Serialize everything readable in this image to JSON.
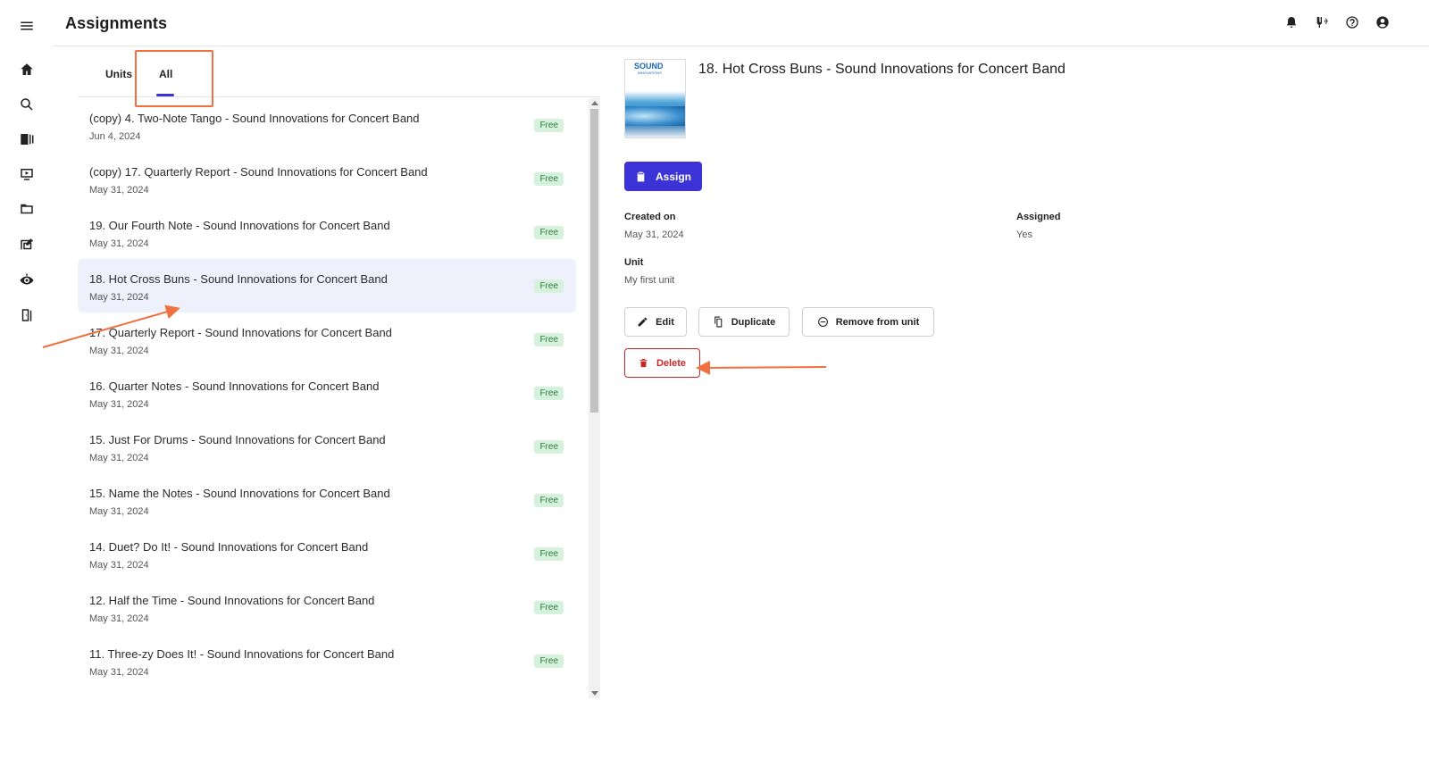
{
  "header": {
    "title": "Assignments"
  },
  "rail": {
    "icons": [
      "menu-icon",
      "home-icon",
      "search-icon",
      "library-icon",
      "video-icon",
      "folder-icon",
      "edit-music-icon",
      "pitch-icon",
      "exit-icon"
    ]
  },
  "topbar": {
    "icons": [
      "bell-icon",
      "tuner-icon",
      "help-icon",
      "account-icon"
    ]
  },
  "tabs": [
    {
      "label": "Units"
    },
    {
      "label": "All",
      "selected": true
    }
  ],
  "assignments": [
    {
      "title": "(copy) 4. Two-Note Tango - Sound Innovations for Concert Band",
      "date": "Jun 4, 2024",
      "badge": "Free"
    },
    {
      "title": "(copy) 17. Quarterly Report - Sound Innovations for Concert Band",
      "date": "May 31, 2024",
      "badge": "Free"
    },
    {
      "title": "19. Our Fourth Note - Sound Innovations for Concert Band",
      "date": "May 31, 2024",
      "badge": "Free"
    },
    {
      "title": "18. Hot Cross Buns - Sound Innovations for Concert Band",
      "date": "May 31, 2024",
      "badge": "Free",
      "selected": true
    },
    {
      "title": "17. Quarterly Report - Sound Innovations for Concert Band",
      "date": "May 31, 2024",
      "badge": "Free"
    },
    {
      "title": "16. Quarter Notes - Sound Innovations for Concert Band",
      "date": "May 31, 2024",
      "badge": "Free"
    },
    {
      "title": "15. Just For Drums - Sound Innovations for Concert Band",
      "date": "May 31, 2024",
      "badge": "Free"
    },
    {
      "title": "15. Name the Notes - Sound Innovations for Concert Band",
      "date": "May 31, 2024",
      "badge": "Free"
    },
    {
      "title": "14. Duet? Do It! - Sound Innovations for Concert Band",
      "date": "May 31, 2024",
      "badge": "Free"
    },
    {
      "title": "12. Half the Time - Sound Innovations for Concert Band",
      "date": "May 31, 2024",
      "badge": "Free"
    },
    {
      "title": "11. Three-zy Does It! - Sound Innovations for Concert Band",
      "date": "May 31, 2024",
      "badge": "Free"
    }
  ],
  "detail": {
    "cover_brand": "SOUND",
    "cover_sub": "INNOVATIONS",
    "title": "18. Hot Cross Buns - Sound Innovations for Concert Band",
    "assign_label": "Assign",
    "created_on_label": "Created on",
    "created_on_value": "May 31, 2024",
    "assigned_label": "Assigned",
    "assigned_value": "Yes",
    "unit_label": "Unit",
    "unit_value": "My first unit",
    "edit_label": "Edit",
    "duplicate_label": "Duplicate",
    "remove_label": "Remove from unit",
    "delete_label": "Delete"
  },
  "colors": {
    "accent": "#3b33d6",
    "danger": "#c62828",
    "annotation": "#f0703f",
    "badge_bg": "#d6f2dc",
    "selected_row": "#eef0fb"
  }
}
